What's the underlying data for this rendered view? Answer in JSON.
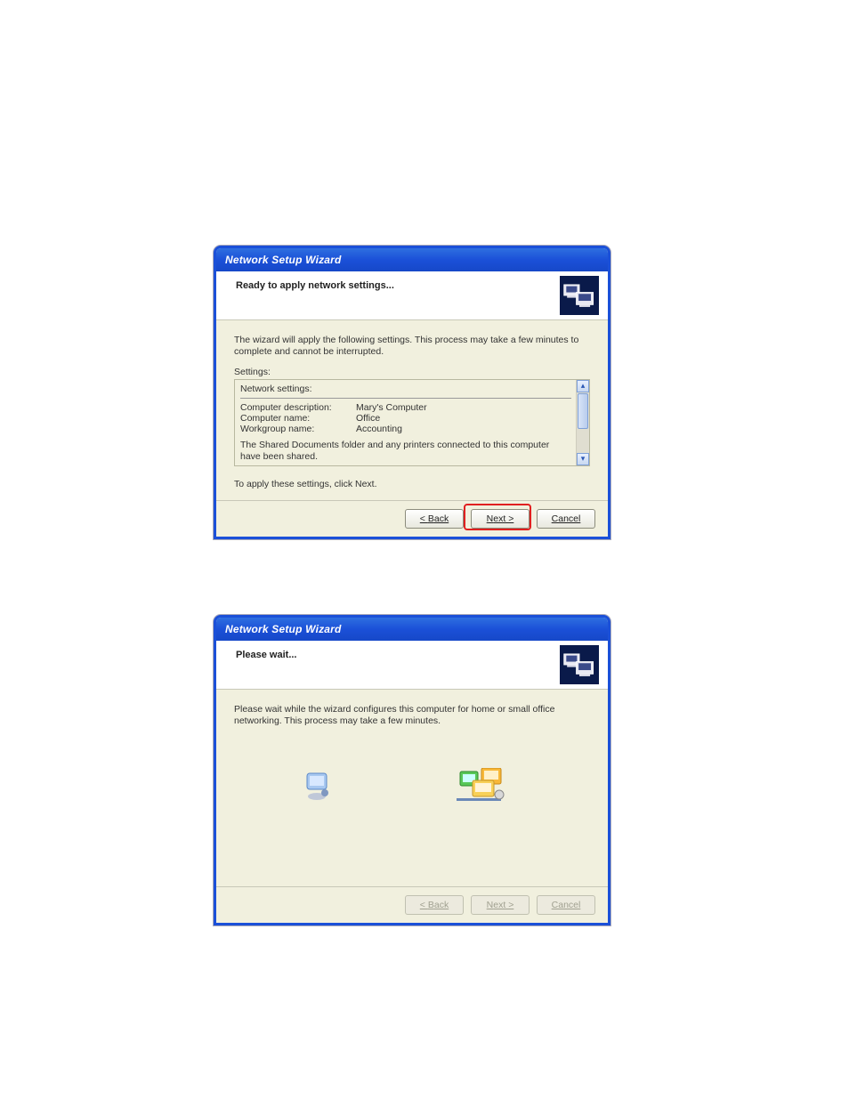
{
  "dialog1": {
    "title": "Network Setup Wizard",
    "header_title": "Ready to apply network settings...",
    "intro": "The wizard will apply the following settings. This process may take a few minutes to complete and cannot be interrupted.",
    "settings_label": "Settings:",
    "pane": {
      "heading": "Network settings:",
      "rows": [
        {
          "label": "Computer description:",
          "value": "Mary's Computer"
        },
        {
          "label": "Computer name:",
          "value": "Office"
        },
        {
          "label": "Workgroup name:",
          "value": "Accounting"
        }
      ],
      "shared_note": "The Shared Documents folder and any printers connected to this computer have been shared."
    },
    "apply_note": "To apply these settings, click Next.",
    "buttons": {
      "back": {
        "pre": "< ",
        "u": "B",
        "post": "ack"
      },
      "next": {
        "pre": "",
        "u": "N",
        "post": "ext >"
      },
      "cancel": {
        "pre": "Cancel",
        "u": "",
        "post": ""
      }
    }
  },
  "dialog2": {
    "title": "Network Setup Wizard",
    "header_title": "Please wait...",
    "intro": "Please wait while the wizard configures this computer for home or small office networking. This process may take a few minutes.",
    "buttons": {
      "back": {
        "pre": "< ",
        "u": "B",
        "post": "ack"
      },
      "next": {
        "pre": "",
        "u": "N",
        "post": "ext >"
      },
      "cancel": {
        "pre": "Cancel",
        "u": "",
        "post": ""
      }
    }
  }
}
